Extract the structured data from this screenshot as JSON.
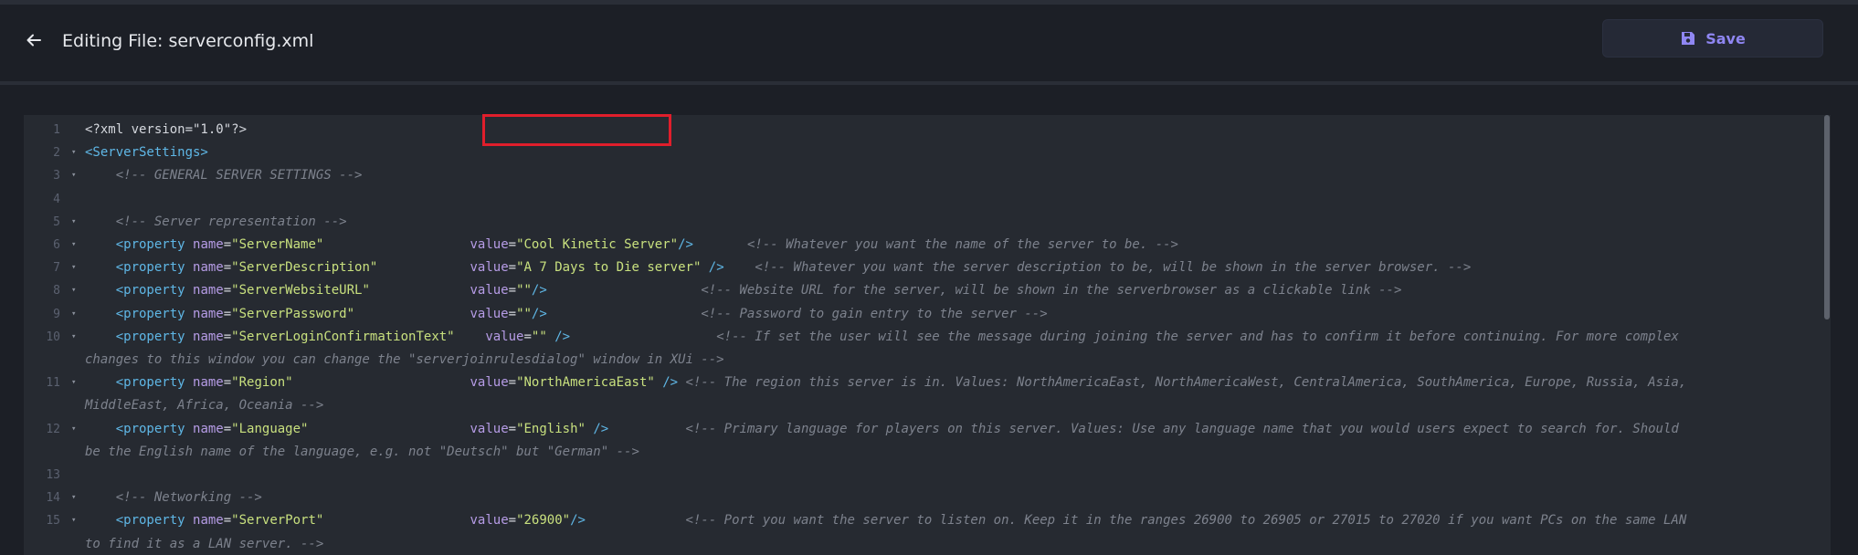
{
  "header": {
    "title": "Editing File: serverconfig.xml",
    "save_label": "Save"
  },
  "editor": {
    "lines": [
      {
        "n": "1",
        "fold": "",
        "parts": [
          {
            "c": "plain",
            "t": "<?xml version=\"1.0\"?>"
          }
        ]
      },
      {
        "n": "2",
        "fold": "▾",
        "parts": [
          {
            "c": "tag",
            "t": "<ServerSettings>"
          }
        ]
      },
      {
        "n": "3",
        "fold": "▾",
        "parts": [
          {
            "c": "comment",
            "t": "    <!-- GENERAL SERVER SETTINGS -->"
          }
        ]
      },
      {
        "n": "4",
        "fold": "",
        "parts": []
      },
      {
        "n": "5",
        "fold": "▾",
        "parts": [
          {
            "c": "comment",
            "t": "    <!-- Server representation -->"
          }
        ]
      },
      {
        "n": "6",
        "fold": "▾",
        "parts": [
          {
            "c": "tag",
            "t": "    <property "
          },
          {
            "c": "attr",
            "t": "name"
          },
          {
            "c": "plain",
            "t": "="
          },
          {
            "c": "str",
            "t": "\"ServerName\""
          },
          {
            "c": "plain",
            "t": "                   "
          },
          {
            "c": "attr",
            "t": "value"
          },
          {
            "c": "plain",
            "t": "="
          },
          {
            "c": "str",
            "t": "\"Cool Kinetic Server\""
          },
          {
            "c": "tag",
            "t": "/>"
          },
          {
            "c": "plain",
            "t": "       "
          },
          {
            "c": "comment",
            "t": "<!-- Whatever you want the name of the server to be. -->"
          }
        ]
      },
      {
        "n": "7",
        "fold": "▾",
        "parts": [
          {
            "c": "tag",
            "t": "    <property "
          },
          {
            "c": "attr",
            "t": "name"
          },
          {
            "c": "plain",
            "t": "="
          },
          {
            "c": "str",
            "t": "\"ServerDescription\""
          },
          {
            "c": "plain",
            "t": "            "
          },
          {
            "c": "attr",
            "t": "value"
          },
          {
            "c": "plain",
            "t": "="
          },
          {
            "c": "str",
            "t": "\"A 7 Days to Die server\""
          },
          {
            "c": "tag",
            "t": " />"
          },
          {
            "c": "plain",
            "t": "    "
          },
          {
            "c": "comment",
            "t": "<!-- Whatever you want the server description to be, will be shown in the server browser. -->"
          }
        ]
      },
      {
        "n": "8",
        "fold": "▾",
        "parts": [
          {
            "c": "tag",
            "t": "    <property "
          },
          {
            "c": "attr",
            "t": "name"
          },
          {
            "c": "plain",
            "t": "="
          },
          {
            "c": "str",
            "t": "\"ServerWebsiteURL\""
          },
          {
            "c": "plain",
            "t": "             "
          },
          {
            "c": "attr",
            "t": "value"
          },
          {
            "c": "plain",
            "t": "="
          },
          {
            "c": "str",
            "t": "\"\""
          },
          {
            "c": "tag",
            "t": "/>"
          },
          {
            "c": "plain",
            "t": "                    "
          },
          {
            "c": "comment",
            "t": "<!-- Website URL for the server, will be shown in the serverbrowser as a clickable link -->"
          }
        ]
      },
      {
        "n": "9",
        "fold": "▾",
        "parts": [
          {
            "c": "tag",
            "t": "    <property "
          },
          {
            "c": "attr",
            "t": "name"
          },
          {
            "c": "plain",
            "t": "="
          },
          {
            "c": "str",
            "t": "\"ServerPassword\""
          },
          {
            "c": "plain",
            "t": "               "
          },
          {
            "c": "attr",
            "t": "value"
          },
          {
            "c": "plain",
            "t": "="
          },
          {
            "c": "str",
            "t": "\"\""
          },
          {
            "c": "tag",
            "t": "/>"
          },
          {
            "c": "plain",
            "t": "                    "
          },
          {
            "c": "comment",
            "t": "<!-- Password to gain entry to the server -->"
          }
        ]
      },
      {
        "n": "10",
        "fold": "▾",
        "parts": [
          {
            "c": "tag",
            "t": "    <property "
          },
          {
            "c": "attr",
            "t": "name"
          },
          {
            "c": "plain",
            "t": "="
          },
          {
            "c": "str",
            "t": "\"ServerLoginConfirmationText\""
          },
          {
            "c": "plain",
            "t": "    "
          },
          {
            "c": "attr",
            "t": "value"
          },
          {
            "c": "plain",
            "t": "="
          },
          {
            "c": "str",
            "t": "\"\""
          },
          {
            "c": "tag",
            "t": " />"
          },
          {
            "c": "plain",
            "t": "                   "
          },
          {
            "c": "comment",
            "t": "<!-- If set the user will see the message during joining the server and has to confirm it before continuing. For more complex"
          }
        ],
        "wrap": [
          {
            "c": "comment",
            "t": "changes to this window you can change the \"serverjoinrulesdialog\" window in XUi -->"
          }
        ]
      },
      {
        "n": "11",
        "fold": "▾",
        "parts": [
          {
            "c": "tag",
            "t": "    <property "
          },
          {
            "c": "attr",
            "t": "name"
          },
          {
            "c": "plain",
            "t": "="
          },
          {
            "c": "str",
            "t": "\"Region\""
          },
          {
            "c": "plain",
            "t": "                       "
          },
          {
            "c": "attr",
            "t": "value"
          },
          {
            "c": "plain",
            "t": "="
          },
          {
            "c": "str",
            "t": "\"NorthAmericaEast\""
          },
          {
            "c": "tag",
            "t": " />"
          },
          {
            "c": "plain",
            "t": " "
          },
          {
            "c": "comment",
            "t": "<!-- The region this server is in. Values: NorthAmericaEast, NorthAmericaWest, CentralAmerica, SouthAmerica, Europe, Russia, Asia,"
          }
        ],
        "wrap": [
          {
            "c": "comment",
            "t": "MiddleEast, Africa, Oceania -->"
          }
        ]
      },
      {
        "n": "12",
        "fold": "▾",
        "parts": [
          {
            "c": "tag",
            "t": "    <property "
          },
          {
            "c": "attr",
            "t": "name"
          },
          {
            "c": "plain",
            "t": "="
          },
          {
            "c": "str",
            "t": "\"Language\""
          },
          {
            "c": "plain",
            "t": "                     "
          },
          {
            "c": "attr",
            "t": "value"
          },
          {
            "c": "plain",
            "t": "="
          },
          {
            "c": "str",
            "t": "\"English\""
          },
          {
            "c": "tag",
            "t": " />"
          },
          {
            "c": "plain",
            "t": "          "
          },
          {
            "c": "comment",
            "t": "<!-- Primary language for players on this server. Values: Use any language name that you would users expect to search for. Should"
          }
        ],
        "wrap": [
          {
            "c": "comment",
            "t": "be the English name of the language, e.g. not \"Deutsch\" but \"German\" -->"
          }
        ]
      },
      {
        "n": "13",
        "fold": "",
        "parts": []
      },
      {
        "n": "14",
        "fold": "▾",
        "parts": [
          {
            "c": "comment",
            "t": "    <!-- Networking -->"
          }
        ]
      },
      {
        "n": "15",
        "fold": "▾",
        "parts": [
          {
            "c": "tag",
            "t": "    <property "
          },
          {
            "c": "attr",
            "t": "name"
          },
          {
            "c": "plain",
            "t": "="
          },
          {
            "c": "str",
            "t": "\"ServerPort\""
          },
          {
            "c": "plain",
            "t": "                   "
          },
          {
            "c": "attr",
            "t": "value"
          },
          {
            "c": "plain",
            "t": "="
          },
          {
            "c": "str",
            "t": "\"26900\""
          },
          {
            "c": "tag",
            "t": "/>"
          },
          {
            "c": "plain",
            "t": "             "
          },
          {
            "c": "comment",
            "t": "<!-- Port you want the server to listen on. Keep it in the ranges 26900 to 26905 or 27015 to 27020 if you want PCs on the same LAN"
          }
        ],
        "wrap": [
          {
            "c": "comment",
            "t": "to find it as a LAN server. -->"
          }
        ]
      }
    ]
  },
  "colors": {
    "background": "#1c1f26",
    "editor_bg": "#262a31",
    "accent": "#8f86f2",
    "highlight": "#e01e2b"
  },
  "icons": {
    "back": "arrow-left-icon",
    "save": "floppy-disk-icon"
  }
}
